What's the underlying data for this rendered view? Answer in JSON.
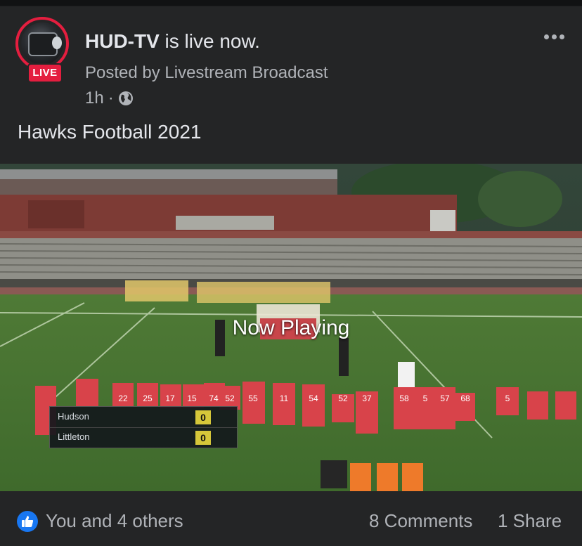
{
  "post": {
    "author": "HUD-TV",
    "status_suffix": "is live now.",
    "posted_by": "Posted by Livestream Broadcast",
    "time": "1h",
    "separator": "·",
    "live_badge": "LIVE",
    "text": "Hawks Football 2021",
    "privacy_icon": "globe-icon",
    "menu_icon": "more-horizontal-icon"
  },
  "video": {
    "overlay": "Now Playing",
    "scoreboard": [
      {
        "team": "Hudson",
        "score": "0"
      },
      {
        "team": "Littleton",
        "score": "0"
      }
    ],
    "jerseys": [
      "22",
      "25",
      "17",
      "15",
      "74",
      "52",
      "55",
      "11",
      "54",
      "52",
      "37",
      "58",
      "5",
      "57",
      "68",
      "5"
    ]
  },
  "footer": {
    "reaction_icon": "thumbs-up-icon",
    "reactions": "You and 4 others",
    "comments": "8 Comments",
    "shares": "1 Share"
  },
  "colors": {
    "background": "#242526",
    "live_red": "#e41e3f",
    "like_blue": "#1877f2",
    "score_yellow": "#d6c73a",
    "jersey_red": "#d8434a"
  }
}
